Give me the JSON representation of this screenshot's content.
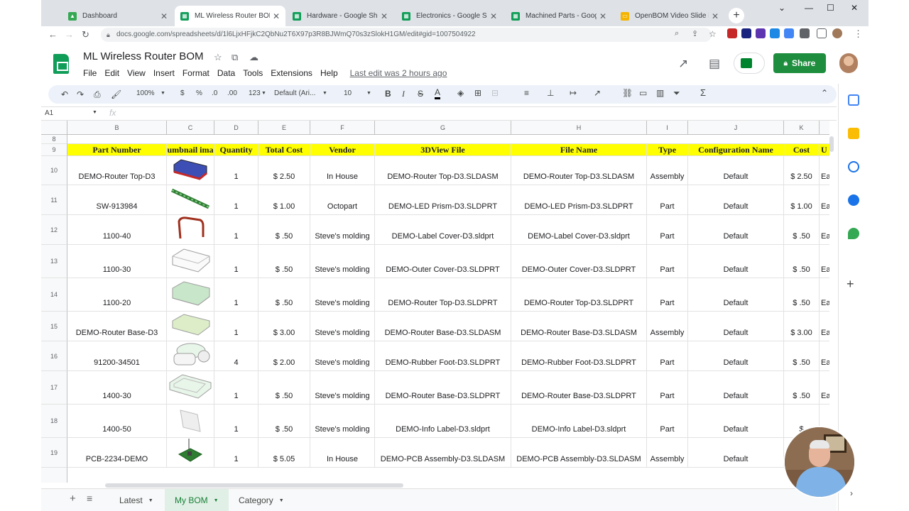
{
  "browser": {
    "tabs": [
      {
        "label": "Dashboard",
        "icon": "google-drive-icon",
        "color": "#fbbc04"
      },
      {
        "label": "ML Wireless Router BOM",
        "icon": "sheets-icon",
        "color": "#0f9d58"
      },
      {
        "label": "Hardware - Google Sheet",
        "icon": "sheets-icon",
        "color": "#0f9d58"
      },
      {
        "label": "Electronics - Google Shee",
        "icon": "sheets-icon",
        "color": "#0f9d58"
      },
      {
        "label": "Machined Parts - Google",
        "icon": "sheets-icon",
        "color": "#0f9d58"
      },
      {
        "label": "OpenBOM Video Slide im",
        "icon": "slides-icon",
        "color": "#f4b400"
      }
    ],
    "url": "docs.google.com/spreadsheets/d/1l6LjxHFjkC2QbNu2T6X97p3R8BJWmQ70s3zSlokH1GM/edit#gid=1007504922"
  },
  "doc": {
    "title": "ML Wireless Router BOM",
    "menu": [
      "File",
      "Edit",
      "View",
      "Insert",
      "Format",
      "Data",
      "Tools",
      "Extensions",
      "Help"
    ],
    "last_edit": "Last edit was 2 hours ago",
    "share_label": "Share"
  },
  "toolbar": {
    "zoom": "100%",
    "currency": "$",
    "percent": "%",
    "dec_decrease": ".0",
    "dec_increase": ".00",
    "number_format": "123",
    "font": "Default (Ari...",
    "font_size": "10"
  },
  "formula_bar": {
    "cell_ref": "A1",
    "fx": "fx"
  },
  "columns": [
    "B",
    "C",
    "D",
    "E",
    "F",
    "G",
    "H",
    "I",
    "J",
    "K"
  ],
  "header_row": {
    "part_number": "Part Number",
    "thumbnail": "umbnail ima",
    "quantity": "Quantity",
    "total_cost": "Total Cost",
    "vendor": "Vendor",
    "view3d": "3DView File",
    "file_name": "File Name",
    "type": "Type",
    "config": "Configuration Name",
    "cost": "Cost",
    "unit": "U"
  },
  "rows": [
    {
      "num": "10",
      "part": "DEMO-Router Top-D3",
      "qty": "1",
      "total": "$ 2.50",
      "vendor": "In House",
      "view3d": "DEMO-Router Top-D3.SLDASM",
      "file": "DEMO-Router Top-D3.SLDASM",
      "type": "Assembly",
      "config": "Default",
      "cost": "$ 2.50",
      "unit": "Ea",
      "thumb": "blue-router-top"
    },
    {
      "num": "11",
      "part": "SW-913984",
      "qty": "1",
      "total": "$ 1.00",
      "vendor": "Octopart",
      "view3d": "DEMO-LED Prism-D3.SLDPRT",
      "file": "DEMO-LED Prism-D3.SLDPRT",
      "type": "Part",
      "config": "Default",
      "cost": "$ 1.00",
      "unit": "Ea",
      "thumb": "green-led-prism"
    },
    {
      "num": "12",
      "part": "1100-40",
      "qty": "1",
      "total": "$ .50",
      "vendor": "Steve's molding",
      "view3d": "DEMO-Label Cover-D3.sldprt",
      "file": "DEMO-Label Cover-D3.sldprt",
      "type": "Part",
      "config": "Default",
      "cost": "$ .50",
      "unit": "Ea",
      "thumb": "red-label-cover"
    },
    {
      "num": "13",
      "part": "1100-30",
      "qty": "1",
      "total": "$ .50",
      "vendor": "Steve's molding",
      "view3d": "DEMO-Outer Cover-D3.SLDPRT",
      "file": "DEMO-Outer Cover-D3.SLDPRT",
      "type": "Part",
      "config": "Default",
      "cost": "$ .50",
      "unit": "Ea",
      "thumb": "outline-outer-cover"
    },
    {
      "num": "14",
      "part": "1100-20",
      "qty": "1",
      "total": "$ .50",
      "vendor": "Steve's molding",
      "view3d": "DEMO-Router Top-D3.SLDPRT",
      "file": "DEMO-Router Top-D3.SLDPRT",
      "type": "Part",
      "config": "Default",
      "cost": "$ .50",
      "unit": "Ea",
      "thumb": "green-router-top"
    },
    {
      "num": "15",
      "part": "DEMO-Router Base-D3",
      "qty": "1",
      "total": "$ 3.00",
      "vendor": "Steve's molding",
      "view3d": "DEMO-Router Base-D3.SLDASM",
      "file": "DEMO-Router Base-D3.SLDASM",
      "type": "Assembly",
      "config": "Default",
      "cost": "$ 3.00",
      "unit": "Ea",
      "thumb": "green-router-base"
    },
    {
      "num": "16",
      "part": "91200-34501",
      "qty": "4",
      "total": "$ 2.00",
      "vendor": "Steve's molding",
      "view3d": "DEMO-Rubber Foot-D3.SLDPRT",
      "file": "DEMO-Rubber Foot-D3.SLDPRT",
      "type": "Part",
      "config": "Default",
      "cost": "$ .50",
      "unit": "Ea",
      "thumb": "rubber-foot"
    },
    {
      "num": "17",
      "part": "1400-30",
      "qty": "1",
      "total": "$ .50",
      "vendor": "Steve's molding",
      "view3d": "DEMO-Router Base-D3.SLDPRT",
      "file": "DEMO-Router Base-D3.SLDPRT",
      "type": "Part",
      "config": "Default",
      "cost": "$ .50",
      "unit": "Ea",
      "thumb": "router-base-part"
    },
    {
      "num": "18",
      "part": "1400-50",
      "qty": "1",
      "total": "$ .50",
      "vendor": "Steve's molding",
      "view3d": "DEMO-Info Label-D3.sldprt",
      "file": "DEMO-Info Label-D3.sldprt",
      "type": "Part",
      "config": "Default",
      "cost": "$",
      "unit": "",
      "thumb": "info-label"
    },
    {
      "num": "19",
      "part": "PCB-2234-DEMO",
      "qty": "1",
      "total": "$ 5.05",
      "vendor": "In House",
      "view3d": "DEMO-PCB Assembly-D3.SLDASM",
      "file": "DEMO-PCB Assembly-D3.SLDASM",
      "type": "Assembly",
      "config": "Default",
      "cost": "",
      "unit": "",
      "thumb": "pcb-assembly"
    }
  ],
  "sheets": {
    "tabs": [
      "Latest",
      "My BOM",
      "Category"
    ],
    "active": "My BOM"
  }
}
